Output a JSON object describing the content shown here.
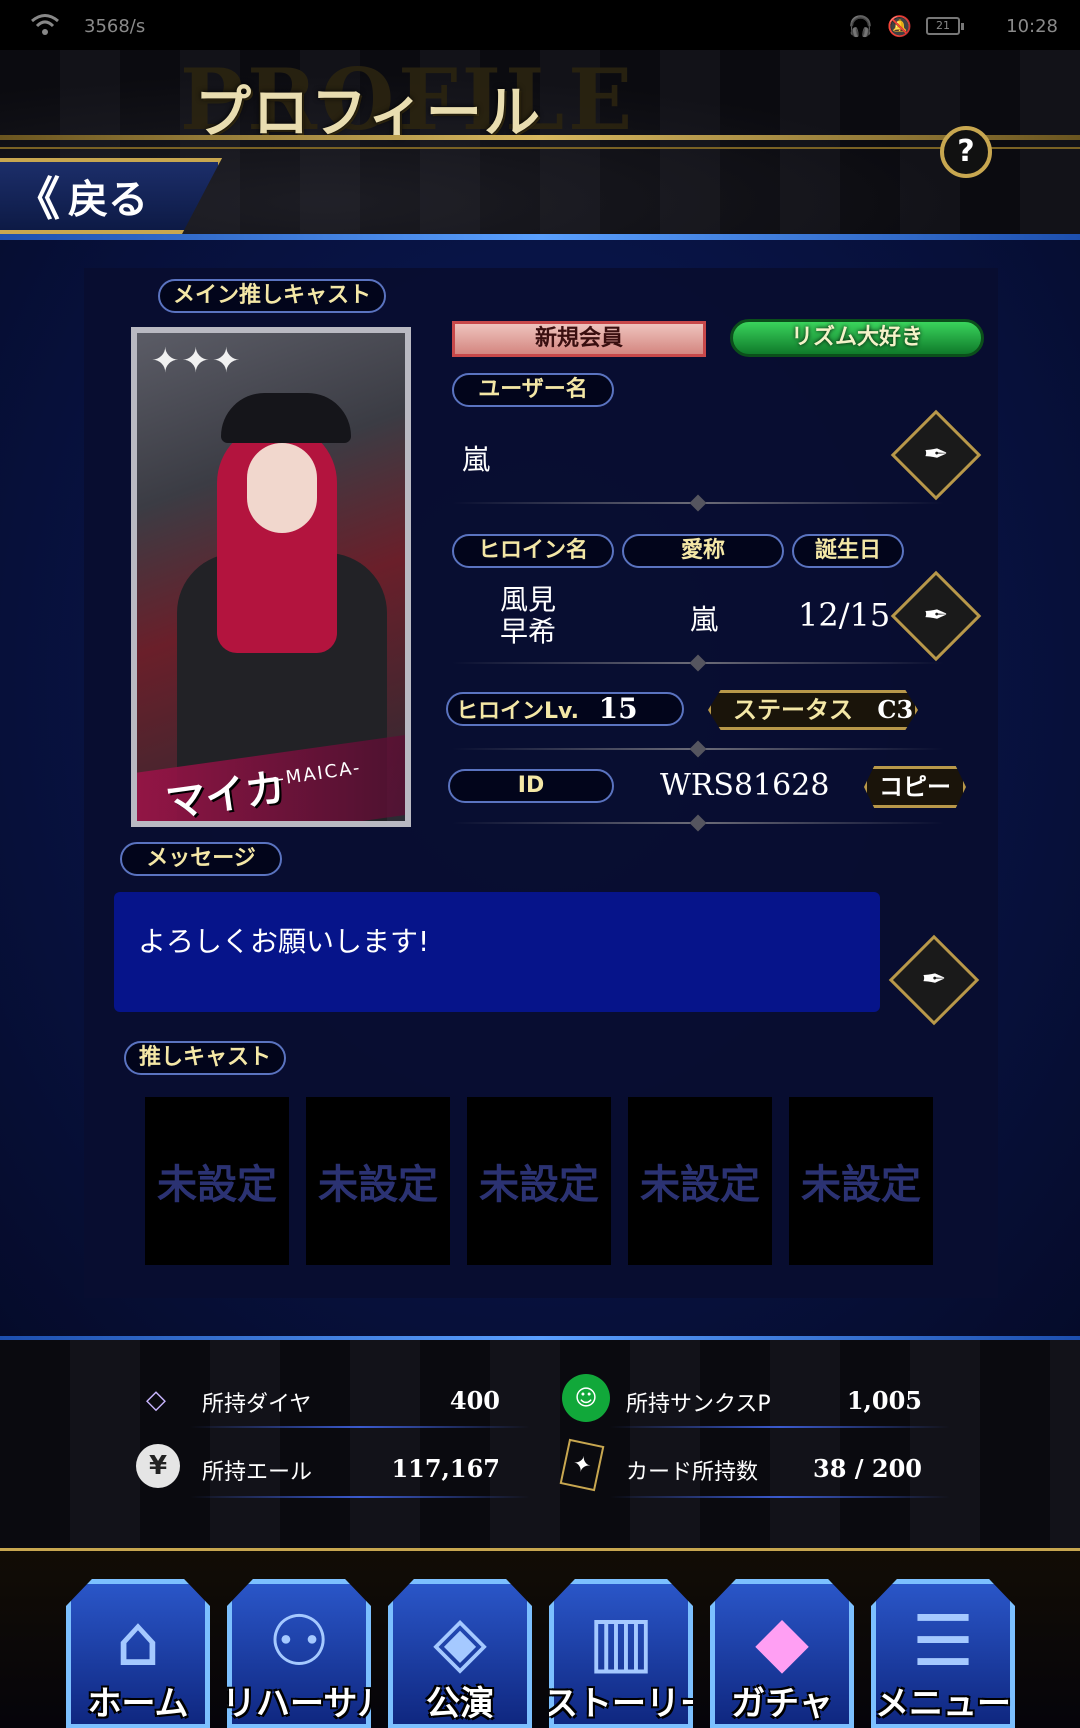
{
  "status_bar": {
    "net_speed": "3568/s",
    "battery": "21",
    "time": "10:28"
  },
  "header": {
    "ghost_title": "PROFILE",
    "title": "プロフィール",
    "back_label": "戻る",
    "back_chevron": "《",
    "help_label": "?"
  },
  "profile": {
    "main_cast_label": "メイン推しキャスト",
    "card": {
      "stars": "✦✦✦",
      "name": "マイカ",
      "name_en": "-MAICA-"
    },
    "badges": {
      "member": "新規会員",
      "title": "リズム大好き"
    },
    "username_label": "ユーザー名",
    "username": "嵐",
    "heroine_name_label": "ヒロイン名",
    "nickname_label": "愛称",
    "birthday_label": "誕生日",
    "heroine_name": "風見早希",
    "heroine_name_line1": "風見",
    "heroine_name_line2": "早希",
    "nickname": "嵐",
    "birthday": "12/15",
    "heroine_lv_label": "ヒロインLv.",
    "heroine_lv": "15",
    "status_label": "ステータス",
    "status_value": "C3",
    "id_label": "ID",
    "id_value": "WRS81628",
    "copy_label": "コピー",
    "message_label": "メッセージ",
    "message": "よろしくお願いします!",
    "oshi_label": "推しキャスト",
    "oshi_slots": [
      "未設定",
      "未設定",
      "未設定",
      "未設定",
      "未設定"
    ]
  },
  "currency": {
    "diamonds_label": "所持ダイヤ",
    "diamonds": "400",
    "thanks_label": "所持サンクスP",
    "thanks": "1,005",
    "yell_label": "所持エール",
    "yell": "117,167",
    "cards_label": "カード所持数",
    "cards": "38 / 200"
  },
  "nav": [
    {
      "label": "ホーム",
      "icon": "home-icon"
    },
    {
      "label": "リハーサル",
      "icon": "rehearsal-icon"
    },
    {
      "label": "公演",
      "icon": "performance-icon"
    },
    {
      "label": "ストーリー",
      "icon": "book-icon"
    },
    {
      "label": "ガチャ",
      "icon": "diamond-icon"
    },
    {
      "label": "メニュー",
      "icon": "notepad-icon"
    }
  ],
  "colors": {
    "gold": "#c8a750",
    "panel": "#080e30",
    "accent_blue": "#5aa0ff",
    "message_bg": "#06148a"
  }
}
